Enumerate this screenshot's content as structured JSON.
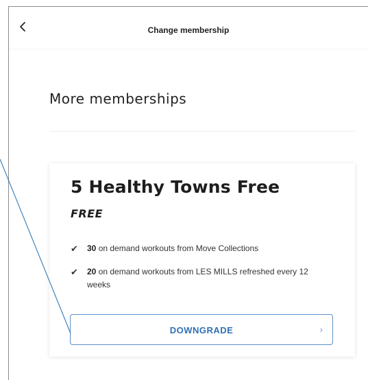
{
  "header": {
    "title": "Change membership",
    "back_icon": "chevron-left-icon"
  },
  "section": {
    "title": "More memberships"
  },
  "membership_card": {
    "name": "5 Healthy Towns Free",
    "price": "FREE",
    "features": [
      {
        "count": "30",
        "text": " on demand workouts from Move Collections"
      },
      {
        "count": "20",
        "text": " on demand workouts from LES MILLS refreshed every 12 weeks"
      }
    ],
    "check_icon": "checkmark-icon",
    "action_label": "DOWNGRADE",
    "action_icon": "chevron-right-icon"
  },
  "colors": {
    "accent": "#2f6fb6",
    "button_border": "#5b8fc9",
    "annotation_line": "#1f6fb2"
  }
}
